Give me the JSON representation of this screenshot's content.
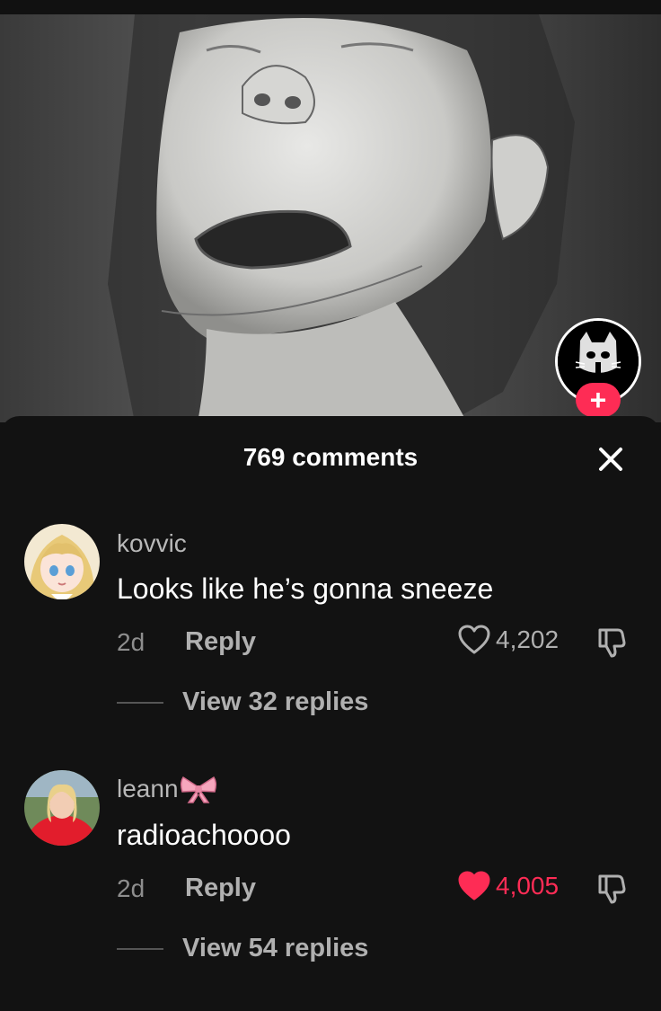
{
  "sheet": {
    "title": "769 comments"
  },
  "follow": {
    "label": "+"
  },
  "comments": [
    {
      "username": "kovvic",
      "text": "Looks like he’s gonna sneeze",
      "time": "2d",
      "reply_label": "Reply",
      "likes": "4,202",
      "liked": false,
      "view_replies": "View 32 replies"
    },
    {
      "username": "leann",
      "text": "radioachoooo",
      "time": "2d",
      "reply_label": "Reply",
      "likes": "4,005",
      "liked": true,
      "view_replies": "View 54 replies"
    }
  ],
  "colors": {
    "accent": "#fe2c55",
    "sheet_bg": "#121212",
    "muted_text": "#b0b0b0"
  },
  "icons": {
    "close": "close-icon",
    "heart": "heart-icon",
    "dislike": "dislike-icon",
    "bow": "bow-emoji-icon"
  }
}
